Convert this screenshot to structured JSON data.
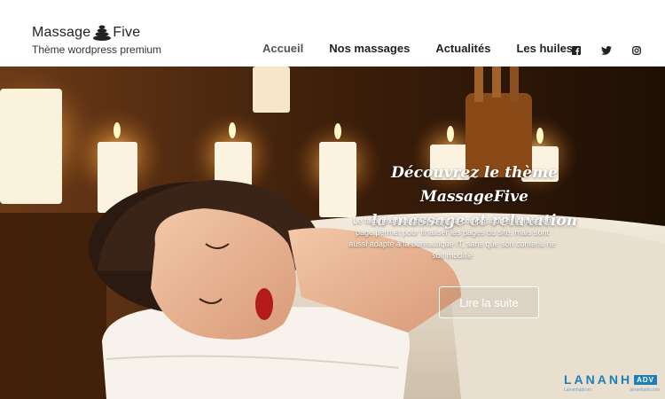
{
  "header": {
    "logo_part1": "Massage",
    "logo_part2": "Five",
    "tagline": "Thème wordpress premium",
    "logo_icon": "stacked-stones-icon"
  },
  "nav": {
    "items": [
      {
        "label": "Accueil",
        "active": true
      },
      {
        "label": "Nos massages",
        "active": false
      },
      {
        "label": "Actualités",
        "active": false
      },
      {
        "label": "Les huiles",
        "active": false
      }
    ]
  },
  "social": {
    "icons": [
      "facebook-icon",
      "twitter-icon",
      "instagram-icon"
    ]
  },
  "hero": {
    "title_line1": "Découvrez le thème MassageFive",
    "title_line2": "la massage et relaxation",
    "text": "Le faux texte ici utilisé dans la composition et la mise en page permet pour finaliser les pages du site, mais sont aussi adapté à la bureautique IT, sans que son contenu ne soit modifié",
    "cta_label": "Lire la suite"
  },
  "watermark": {
    "brand": "LANANH",
    "badge": "ADV",
    "left_caption": "Lananhadv.vn",
    "right_caption": "lananhadv.com"
  },
  "colors": {
    "accent_blue": "#1e7fb8",
    "hero_dark": "#3a1e0a",
    "text_dark": "#222222"
  }
}
